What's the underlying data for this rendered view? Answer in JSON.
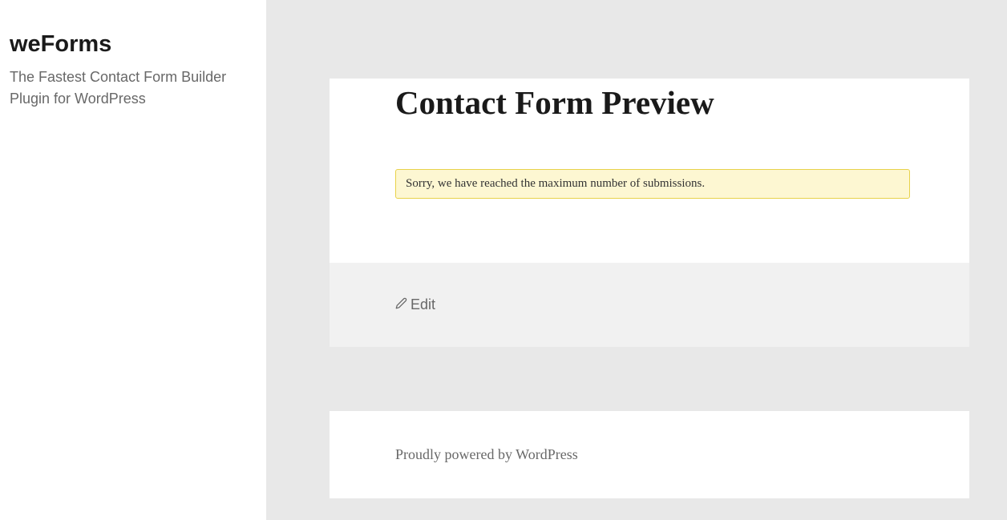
{
  "sidebar": {
    "site_title": "weForms",
    "site_tagline": "The Fastest Contact Form Builder Plugin for WordPress"
  },
  "main": {
    "page_title": "Contact Form Preview",
    "notice_message": "Sorry, we have reached the maximum number of submissions.",
    "edit_label": "Edit"
  },
  "footer": {
    "text": "Proudly powered by WordPress"
  }
}
